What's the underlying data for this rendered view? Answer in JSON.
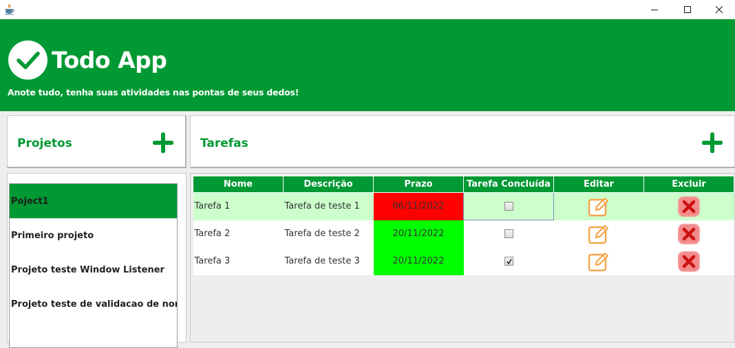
{
  "window": {
    "icon": "java-cup-icon",
    "controls": [
      "minimize",
      "maximize",
      "close"
    ]
  },
  "header": {
    "title": "Todo App",
    "subtitle": "Anote tudo, tenha suas atividades nas pontas de seus dedos!",
    "logo_icon": "check-circle-icon"
  },
  "projects": {
    "title": "Projetos",
    "add_icon": "plus-icon",
    "items": [
      {
        "label": "Poject1",
        "selected": true
      },
      {
        "label": "Primeiro projeto",
        "selected": false
      },
      {
        "label": "Projeto teste Window Listener",
        "selected": false
      },
      {
        "label": "Projeto teste de validacao de nome",
        "selected": false
      }
    ]
  },
  "tasks": {
    "title": "Tarefas",
    "add_icon": "plus-icon",
    "columns": [
      "Nome",
      "Descrição",
      "Prazo",
      "Tarefa Concluída",
      "Editar",
      "Excluir"
    ],
    "rows": [
      {
        "name": "Tarefa 1",
        "description": "Tarefa de teste 1",
        "deadline": "06/11/2022",
        "done": false,
        "deadline_status": "late"
      },
      {
        "name": "Tarefa 2",
        "description": "Tarefa de teste 2",
        "deadline": "20/11/2022",
        "done": false,
        "deadline_status": "ok"
      },
      {
        "name": "Tarefa 3",
        "description": "Tarefa de teste 3",
        "deadline": "20/11/2022",
        "done": true,
        "deadline_status": "ok"
      }
    ],
    "edit_icon": "edit-icon",
    "delete_icon": "delete-icon"
  },
  "colors": {
    "brand_green": "#009933",
    "row_highlight": "#ccffcc",
    "deadline_late": "#ff0000",
    "deadline_ok": "#00ff00",
    "edit_orange": "#f5a54a",
    "delete_red": "#cc1111"
  }
}
